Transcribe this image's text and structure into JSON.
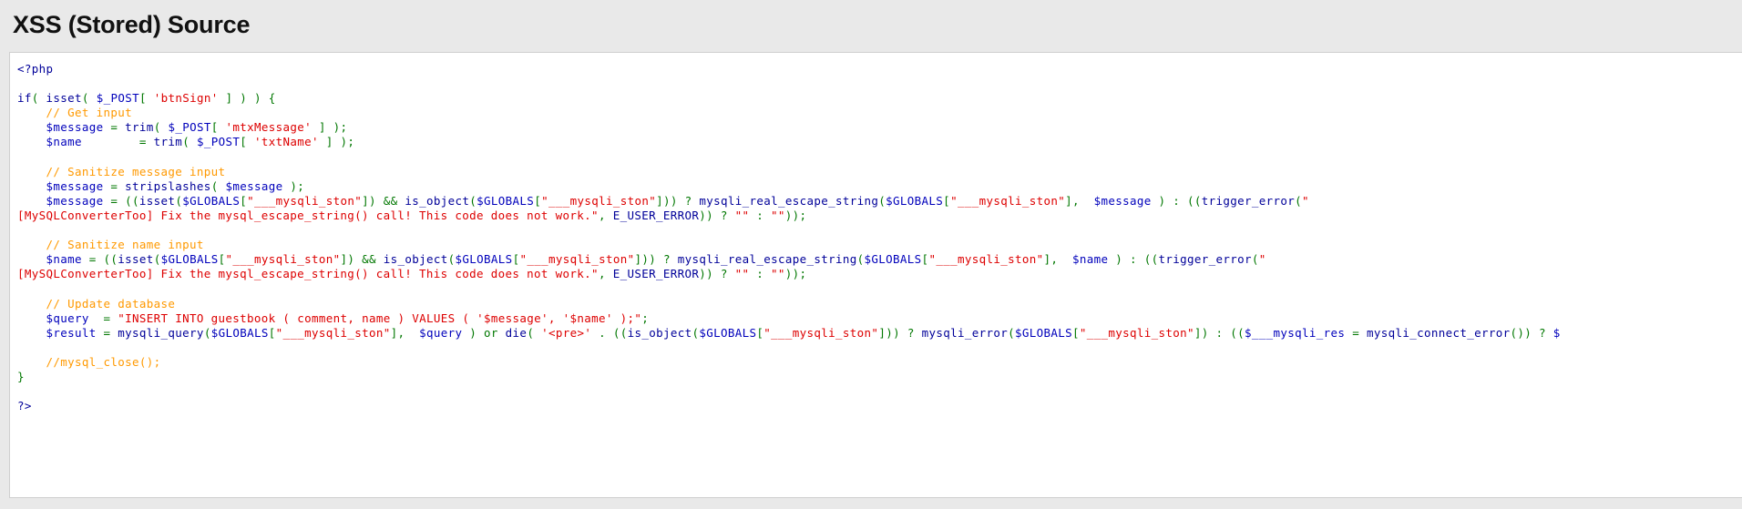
{
  "page": {
    "title": "XSS (Stored) Source",
    "background_color": "#e9e9e9",
    "code_background_color": "#ffffff",
    "code_border_color": "#cfcfcf"
  },
  "syntax_colors": {
    "default": "#000099",
    "keyword": "#000099",
    "comment": "#ff9900",
    "string": "#dd0000",
    "variable": "#0000bb",
    "punctuation": "#007700",
    "text": "#222222"
  },
  "code": {
    "language": "php",
    "lines": [
      {
        "indent": 0,
        "tokens": [
          {
            "t": "tag",
            "v": "<?php"
          }
        ]
      },
      {
        "indent": 0,
        "tokens": []
      },
      {
        "indent": 0,
        "tokens": [
          {
            "t": "keyword",
            "v": "if"
          },
          {
            "t": "punct",
            "v": "( "
          },
          {
            "t": "keyword",
            "v": "isset"
          },
          {
            "t": "punct",
            "v": "( "
          },
          {
            "t": "var",
            "v": "$_POST"
          },
          {
            "t": "punct",
            "v": "[ "
          },
          {
            "t": "string",
            "v": "'btnSign'"
          },
          {
            "t": "punct",
            "v": " ] ) ) {"
          }
        ]
      },
      {
        "indent": 1,
        "tokens": [
          {
            "t": "comment",
            "v": "// Get input"
          }
        ]
      },
      {
        "indent": 1,
        "tokens": [
          {
            "t": "var",
            "v": "$message"
          },
          {
            "t": "punct",
            "v": " = "
          },
          {
            "t": "keyword",
            "v": "trim"
          },
          {
            "t": "punct",
            "v": "( "
          },
          {
            "t": "var",
            "v": "$_POST"
          },
          {
            "t": "punct",
            "v": "[ "
          },
          {
            "t": "string",
            "v": "'mtxMessage'"
          },
          {
            "t": "punct",
            "v": " ] );"
          }
        ]
      },
      {
        "indent": 1,
        "tokens": [
          {
            "t": "var",
            "v": "$name"
          },
          {
            "t": "punct",
            "v": "        = "
          },
          {
            "t": "keyword",
            "v": "trim"
          },
          {
            "t": "punct",
            "v": "( "
          },
          {
            "t": "var",
            "v": "$_POST"
          },
          {
            "t": "punct",
            "v": "[ "
          },
          {
            "t": "string",
            "v": "'txtName'"
          },
          {
            "t": "punct",
            "v": " ] );"
          }
        ]
      },
      {
        "indent": 0,
        "tokens": []
      },
      {
        "indent": 1,
        "tokens": [
          {
            "t": "comment",
            "v": "// Sanitize message input"
          }
        ]
      },
      {
        "indent": 1,
        "tokens": [
          {
            "t": "var",
            "v": "$message"
          },
          {
            "t": "punct",
            "v": " = "
          },
          {
            "t": "keyword",
            "v": "stripslashes"
          },
          {
            "t": "punct",
            "v": "( "
          },
          {
            "t": "var",
            "v": "$message"
          },
          {
            "t": "punct",
            "v": " );"
          }
        ]
      },
      {
        "indent": 1,
        "tokens": [
          {
            "t": "var",
            "v": "$message"
          },
          {
            "t": "punct",
            "v": " = (("
          },
          {
            "t": "keyword",
            "v": "isset"
          },
          {
            "t": "punct",
            "v": "("
          },
          {
            "t": "var",
            "v": "$GLOBALS"
          },
          {
            "t": "punct",
            "v": "["
          },
          {
            "t": "string",
            "v": "\"___mysqli_ston\""
          },
          {
            "t": "punct",
            "v": "]) && "
          },
          {
            "t": "keyword",
            "v": "is_object"
          },
          {
            "t": "punct",
            "v": "("
          },
          {
            "t": "var",
            "v": "$GLOBALS"
          },
          {
            "t": "punct",
            "v": "["
          },
          {
            "t": "string",
            "v": "\"___mysqli_ston\""
          },
          {
            "t": "punct",
            "v": "])) ? "
          },
          {
            "t": "keyword",
            "v": "mysqli_real_escape_string"
          },
          {
            "t": "punct",
            "v": "("
          },
          {
            "t": "var",
            "v": "$GLOBALS"
          },
          {
            "t": "punct",
            "v": "["
          },
          {
            "t": "string",
            "v": "\"___mysqli_ston\""
          },
          {
            "t": "punct",
            "v": "],  "
          },
          {
            "t": "var",
            "v": "$message"
          },
          {
            "t": "punct",
            "v": " ) : (("
          },
          {
            "t": "keyword",
            "v": "trigger_error"
          },
          {
            "t": "punct",
            "v": "("
          },
          {
            "t": "string",
            "v": "\""
          }
        ]
      },
      {
        "indent": 0,
        "wrapped": true,
        "tokens": [
          {
            "t": "string",
            "v": "[MySQLConverterToo] Fix the mysql_escape_string() call! This code does not work.\""
          },
          {
            "t": "punct",
            "v": ", "
          },
          {
            "t": "keyword",
            "v": "E_USER_ERROR"
          },
          {
            "t": "punct",
            "v": ")) ? "
          },
          {
            "t": "string",
            "v": "\"\""
          },
          {
            "t": "punct",
            "v": " : "
          },
          {
            "t": "string",
            "v": "\"\""
          },
          {
            "t": "punct",
            "v": "));"
          }
        ]
      },
      {
        "indent": 0,
        "tokens": []
      },
      {
        "indent": 1,
        "tokens": [
          {
            "t": "comment",
            "v": "// Sanitize name input"
          }
        ]
      },
      {
        "indent": 1,
        "tokens": [
          {
            "t": "var",
            "v": "$name"
          },
          {
            "t": "punct",
            "v": " = (("
          },
          {
            "t": "keyword",
            "v": "isset"
          },
          {
            "t": "punct",
            "v": "("
          },
          {
            "t": "var",
            "v": "$GLOBALS"
          },
          {
            "t": "punct",
            "v": "["
          },
          {
            "t": "string",
            "v": "\"___mysqli_ston\""
          },
          {
            "t": "punct",
            "v": "]) && "
          },
          {
            "t": "keyword",
            "v": "is_object"
          },
          {
            "t": "punct",
            "v": "("
          },
          {
            "t": "var",
            "v": "$GLOBALS"
          },
          {
            "t": "punct",
            "v": "["
          },
          {
            "t": "string",
            "v": "\"___mysqli_ston\""
          },
          {
            "t": "punct",
            "v": "])) ? "
          },
          {
            "t": "keyword",
            "v": "mysqli_real_escape_string"
          },
          {
            "t": "punct",
            "v": "("
          },
          {
            "t": "var",
            "v": "$GLOBALS"
          },
          {
            "t": "punct",
            "v": "["
          },
          {
            "t": "string",
            "v": "\"___mysqli_ston\""
          },
          {
            "t": "punct",
            "v": "],  "
          },
          {
            "t": "var",
            "v": "$name"
          },
          {
            "t": "punct",
            "v": " ) : (("
          },
          {
            "t": "keyword",
            "v": "trigger_error"
          },
          {
            "t": "punct",
            "v": "("
          },
          {
            "t": "string",
            "v": "\""
          }
        ]
      },
      {
        "indent": 0,
        "wrapped": true,
        "tokens": [
          {
            "t": "string",
            "v": "[MySQLConverterToo] Fix the mysql_escape_string() call! This code does not work.\""
          },
          {
            "t": "punct",
            "v": ", "
          },
          {
            "t": "keyword",
            "v": "E_USER_ERROR"
          },
          {
            "t": "punct",
            "v": ")) ? "
          },
          {
            "t": "string",
            "v": "\"\""
          },
          {
            "t": "punct",
            "v": " : "
          },
          {
            "t": "string",
            "v": "\"\""
          },
          {
            "t": "punct",
            "v": "));"
          }
        ]
      },
      {
        "indent": 0,
        "tokens": []
      },
      {
        "indent": 1,
        "tokens": [
          {
            "t": "comment",
            "v": "// Update database"
          }
        ]
      },
      {
        "indent": 1,
        "tokens": [
          {
            "t": "var",
            "v": "$query"
          },
          {
            "t": "punct",
            "v": "  = "
          },
          {
            "t": "string",
            "v": "\"INSERT INTO guestbook ( comment, name ) VALUES ( '$message', '$name' );\""
          },
          {
            "t": "punct",
            "v": ";"
          }
        ]
      },
      {
        "indent": 1,
        "tokens": [
          {
            "t": "var",
            "v": "$result"
          },
          {
            "t": "punct",
            "v": " = "
          },
          {
            "t": "keyword",
            "v": "mysqli_query"
          },
          {
            "t": "punct",
            "v": "("
          },
          {
            "t": "var",
            "v": "$GLOBALS"
          },
          {
            "t": "punct",
            "v": "["
          },
          {
            "t": "string",
            "v": "\"___mysqli_ston\""
          },
          {
            "t": "punct",
            "v": "],  "
          },
          {
            "t": "var",
            "v": "$query"
          },
          {
            "t": "punct",
            "v": " ) or "
          },
          {
            "t": "keyword",
            "v": "die"
          },
          {
            "t": "punct",
            "v": "( "
          },
          {
            "t": "string",
            "v": "'<pre>'"
          },
          {
            "t": "punct",
            "v": " . (("
          },
          {
            "t": "keyword",
            "v": "is_object"
          },
          {
            "t": "punct",
            "v": "("
          },
          {
            "t": "var",
            "v": "$GLOBALS"
          },
          {
            "t": "punct",
            "v": "["
          },
          {
            "t": "string",
            "v": "\"___mysqli_ston\""
          },
          {
            "t": "punct",
            "v": "])) ? "
          },
          {
            "t": "keyword",
            "v": "mysqli_error"
          },
          {
            "t": "punct",
            "v": "("
          },
          {
            "t": "var",
            "v": "$GLOBALS"
          },
          {
            "t": "punct",
            "v": "["
          },
          {
            "t": "string",
            "v": "\"___mysqli_ston\""
          },
          {
            "t": "punct",
            "v": "]) : (("
          },
          {
            "t": "var",
            "v": "$___mysqli_res"
          },
          {
            "t": "punct",
            "v": " = "
          },
          {
            "t": "keyword",
            "v": "mysqli_connect_error"
          },
          {
            "t": "punct",
            "v": "()) ? "
          },
          {
            "t": "var",
            "v": "$"
          }
        ]
      },
      {
        "indent": 0,
        "tokens": []
      },
      {
        "indent": 1,
        "tokens": [
          {
            "t": "comment",
            "v": "//mysql_close();"
          }
        ]
      },
      {
        "indent": 0,
        "tokens": [
          {
            "t": "punct",
            "v": "}"
          }
        ]
      },
      {
        "indent": 0,
        "tokens": []
      },
      {
        "indent": 0,
        "tokens": [
          {
            "t": "tag",
            "v": "?>"
          }
        ]
      }
    ]
  }
}
